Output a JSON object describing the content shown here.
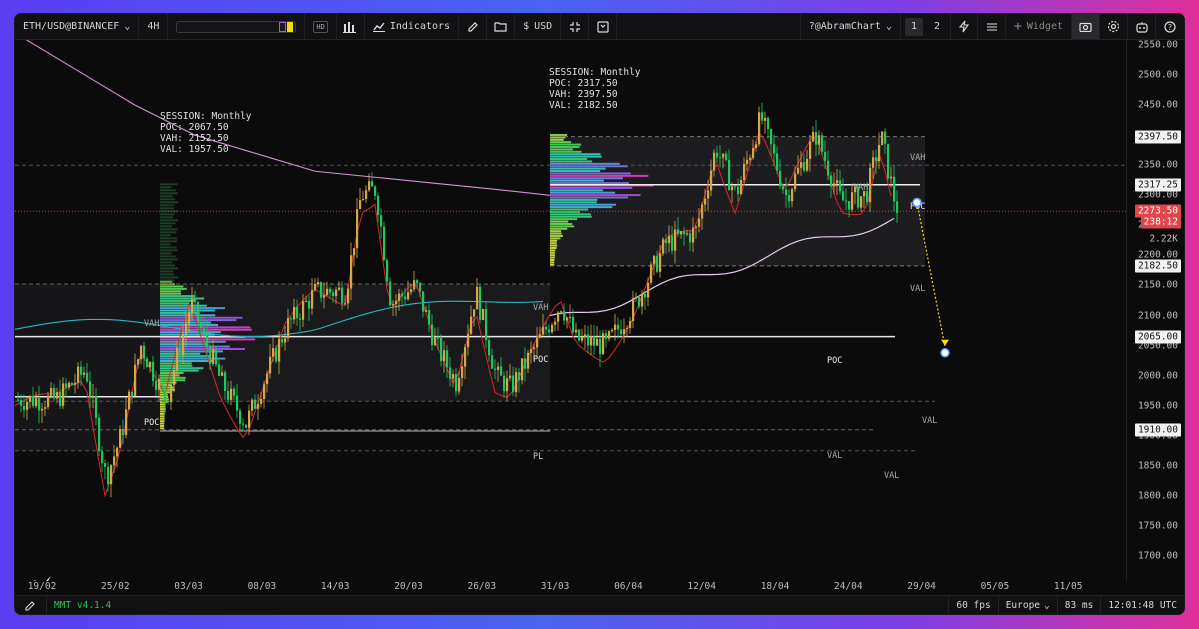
{
  "toolbar": {
    "symbol": "ETH/USD@BINANCEF",
    "timeframe": "4H",
    "hd_badge": "HD",
    "indicators_label": "Indicators",
    "currency": "USD",
    "layout_name": "?@AbramChart",
    "tabs": [
      "1",
      "2"
    ],
    "widget_label": "Widget"
  },
  "status": {
    "version": "MMT v4.1.4",
    "fps": "60 fps",
    "region": "Europe",
    "latency": "83 ms",
    "clock": "12:01:48 UTC"
  },
  "price_axis": {
    "labels": [
      "2550.00",
      "2500.00",
      "2450.00",
      "2400.00",
      "2350.00",
      "2300.00",
      "2250.00",
      "2200.00",
      "2150.00",
      "2100.00",
      "2050.00",
      "2000.00",
      "1950.00",
      "1900.00",
      "1850.00",
      "1800.00",
      "1750.00",
      "1700.00"
    ],
    "tags": [
      {
        "text": "2397.50",
        "style": "white"
      },
      {
        "text": "2317.25",
        "style": "white"
      },
      {
        "text": "2273.50",
        "style": "red"
      },
      {
        "text": "238:12",
        "style": "red"
      },
      {
        "text": "2.22K",
        "style": "plain"
      },
      {
        "text": "2182.50",
        "style": "white"
      },
      {
        "text": "2065.00",
        "style": "white"
      },
      {
        "text": "1910.00",
        "style": "white"
      }
    ]
  },
  "time_axis": [
    "19/02",
    "25/02",
    "03/03",
    "08/03",
    "14/03",
    "20/03",
    "26/03",
    "31/03",
    "06/04",
    "12/04",
    "18/04",
    "24/04",
    "29/04",
    "05/05",
    "11/05"
  ],
  "sessions": [
    {
      "title": "SESSION: Monthly",
      "poc": "POC: 2067.50",
      "vah": "VAH: 2152.50",
      "val": "VAL: 1957.50"
    },
    {
      "title": "SESSION: Monthly",
      "poc": "POC: 2317.50",
      "vah": "VAH: 2397.50",
      "val": "VAL: 2182.50"
    }
  ],
  "level_labels": {
    "vah": "VAH",
    "poc": "POC",
    "val": "VAL",
    "pl": "PL"
  },
  "colors": {
    "accent": "#a855f7",
    "price_red": "#e0454b",
    "candle_up": "#d4a84a",
    "candle_down": "#22c55e",
    "vwap_purple": "#e2b7f0",
    "ma_red": "#dc2626",
    "teal": "#2dd4bf"
  },
  "chart_data": {
    "type": "candlestick",
    "symbol": "ETH/USD@BINANCEF",
    "timeframe": "4H",
    "ylim": [
      1680,
      2570
    ],
    "last_price": 2273.5,
    "sessions": [
      {
        "poc": 2067.5,
        "vah": 2152.5,
        "val": 1957.5
      },
      {
        "poc": 2317.5,
        "vah": 2397.5,
        "val": 2182.5
      }
    ],
    "marked_levels": [
      2397.5,
      2317.25,
      2182.5,
      2065.0,
      1910.0
    ]
  }
}
